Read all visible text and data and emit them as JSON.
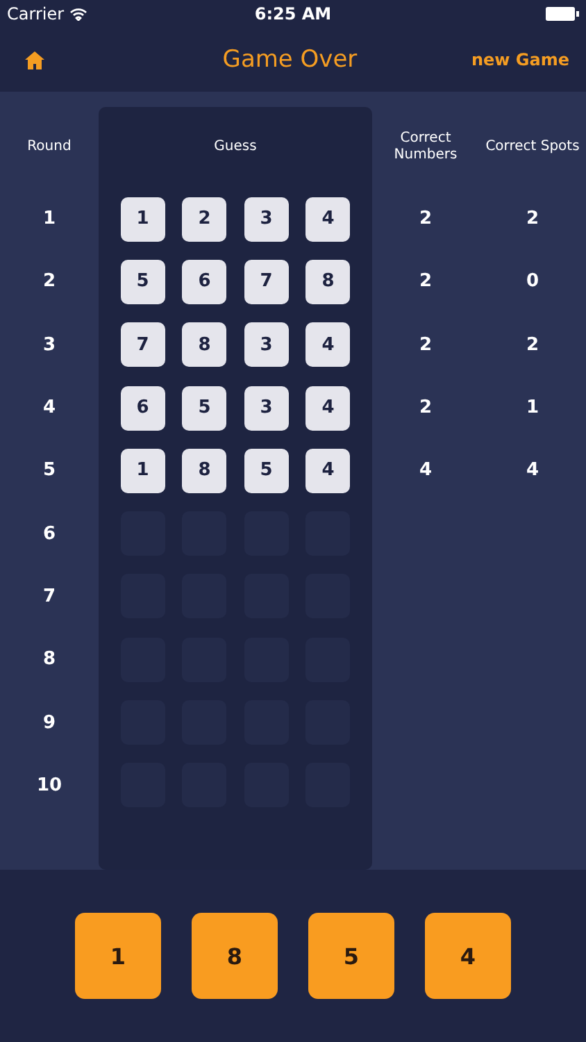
{
  "status_bar": {
    "carrier": "Carrier",
    "time": "6:25 AM"
  },
  "nav": {
    "title": "Game Over",
    "action": "new Game"
  },
  "columns": [
    "Round",
    "Guess",
    "Correct Numbers",
    "Correct Spots"
  ],
  "rounds": [
    {
      "round": "1",
      "guess": [
        "1",
        "2",
        "3",
        "4"
      ],
      "correct_numbers": "2",
      "correct_spots": "2"
    },
    {
      "round": "2",
      "guess": [
        "5",
        "6",
        "7",
        "8"
      ],
      "correct_numbers": "2",
      "correct_spots": "0"
    },
    {
      "round": "3",
      "guess": [
        "7",
        "8",
        "3",
        "4"
      ],
      "correct_numbers": "2",
      "correct_spots": "2"
    },
    {
      "round": "4",
      "guess": [
        "6",
        "5",
        "3",
        "4"
      ],
      "correct_numbers": "2",
      "correct_spots": "1"
    },
    {
      "round": "5",
      "guess": [
        "1",
        "8",
        "5",
        "4"
      ],
      "correct_numbers": "4",
      "correct_spots": "4"
    },
    {
      "round": "6"
    },
    {
      "round": "7"
    },
    {
      "round": "8"
    },
    {
      "round": "9"
    },
    {
      "round": "10"
    }
  ],
  "answer": [
    "1",
    "8",
    "5",
    "4"
  ]
}
